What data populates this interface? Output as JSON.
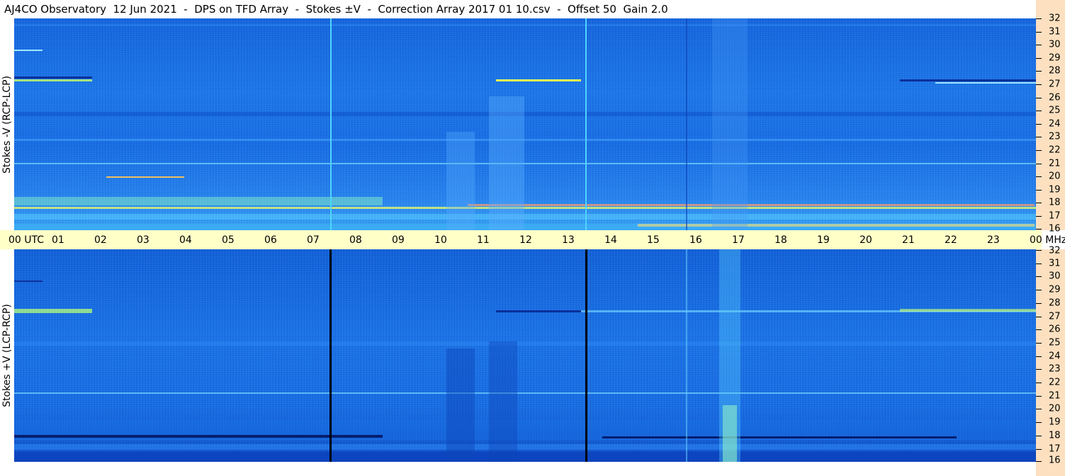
{
  "title": "AJ4CO Observatory  12 Jun 2021  -  DPS on TFD Array  -  Stokes ±V  -  Correction Array 2017 01 10.csv  -  Offset 50  Gain 2.0",
  "top_panel": {
    "ylabel": "Stokes -V (RCP-LCP)"
  },
  "bottom_panel": {
    "ylabel": "Stokes +V (LCP-RCP)"
  },
  "time_axis": {
    "labels": [
      "00 UTC",
      "01",
      "02",
      "03",
      "04",
      "05",
      "06",
      "07",
      "08",
      "09",
      "10",
      "11",
      "12",
      "13",
      "14",
      "15",
      "16",
      "17",
      "18",
      "19",
      "20",
      "21",
      "22",
      "23",
      "00 MHz"
    ]
  },
  "freq_axis": {
    "labels": [
      "32",
      "31",
      "30",
      "29",
      "28",
      "27",
      "26",
      "25",
      "24",
      "23",
      "22",
      "21",
      "20",
      "19",
      "18",
      "17",
      "16"
    ]
  },
  "colors": {
    "spectrogram_base": "#1a6ee0",
    "time_axis_bg": "#ffffc8",
    "freq_axis_bg": "#fde0c0",
    "top_marker_line": "#4fd7ff",
    "bottom_marker_line": "#000000"
  }
}
